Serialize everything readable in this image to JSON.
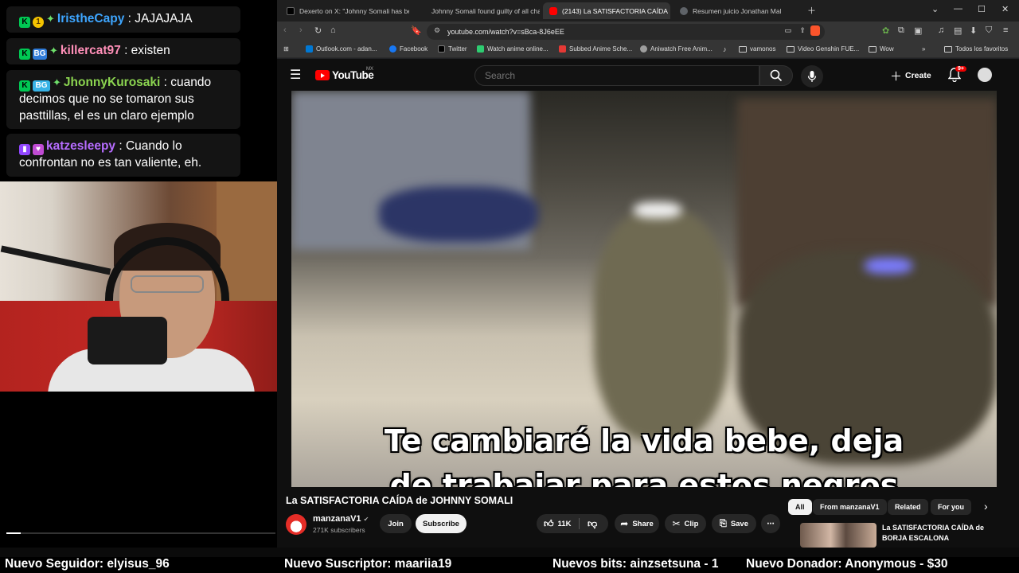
{
  "chat": {
    "messages": [
      {
        "user": "IristheCapy",
        "user_color": "#3ea6ff",
        "text": ": JAJAJAJA",
        "badges": [
          "prime-badge",
          "gold-badge"
        ]
      },
      {
        "user": "killercat97",
        "user_color": "#ff8fb8",
        "text": ": existen",
        "badges": [
          "prime-badge",
          "bits-badge"
        ]
      },
      {
        "user": "JhonnyKurosaki",
        "user_color": "#8bd450",
        "text": ": cuando decimos que no se tomaron sus pasttillas, el es un claro ejemplo",
        "badges": [
          "prime-badge",
          "sub-badge"
        ]
      },
      {
        "user": "katzesleepy",
        "user_color": "#b66cff",
        "text": ": Cuando lo confrontan no es tan valiente, eh.",
        "badges": [
          "twitch-badge",
          "heart-badge"
        ]
      }
    ]
  },
  "browser": {
    "tabs": [
      {
        "title": "Dexerto on X: \"Johnny Somali has be",
        "icon": "x-icon",
        "color": "#000000"
      },
      {
        "title": "Johnny Somali found guilty of all cha",
        "icon": "page-icon",
        "color": "#e02020"
      },
      {
        "title": "(2143) La SATISFACTORIA CAÍDA",
        "icon": "youtube-icon",
        "color": "#ff0000",
        "active": true
      },
      {
        "title": "Resumen juicio Jonathan Mal",
        "icon": "globe-icon",
        "color": "#5f6368"
      }
    ],
    "url": "youtube.com/watch?v=sBca-8J6eEE",
    "bookmarks": [
      {
        "label": "Outlook.com - adan...",
        "icon": "outlook-icon",
        "color": "#0078d4"
      },
      {
        "label": "Facebook",
        "icon": "facebook-icon",
        "color": "#1877f2"
      },
      {
        "label": "Twitter",
        "icon": "x-icon",
        "color": "#000000"
      },
      {
        "label": "Watch anime online...",
        "icon": "anime-icon",
        "color": "#2ecc71"
      },
      {
        "label": "Subbed Anime Sche...",
        "icon": "anime-icon",
        "color": "#e53935"
      },
      {
        "label": "Aniwatch Free Anim...",
        "icon": "aniwatch-icon",
        "color": "#9e9e9e"
      },
      {
        "label": "",
        "icon": "tiktok-icon",
        "color": "#ffffff"
      },
      {
        "label": "vamonos",
        "icon": "folder-icon"
      },
      {
        "label": "Video Genshin FUE...",
        "icon": "folder-icon"
      },
      {
        "label": "Wow",
        "icon": "folder-icon"
      },
      {
        "label": "Todos los favoritos",
        "icon": "folder-icon"
      }
    ]
  },
  "youtube": {
    "logo_text": "YouTube",
    "region": "MX",
    "search_placeholder": "Search",
    "create_label": "Create",
    "notif_count": "9+",
    "subtitle_line1": "Te cambiaré la vida bebe, deja",
    "subtitle_line2": "de trabajar para estos negros",
    "video_title": "La SATISFACTORIA CAÍDA de JOHNNY SOMALI",
    "channel_name": "manzanaV1",
    "subscribers": "271K subscribers",
    "join_label": "Join",
    "subscribe_label": "Subscribe",
    "likes": "11K",
    "share_label": "Share",
    "clip_label": "Clip",
    "save_label": "Save",
    "chips": [
      "All",
      "From manzanaV1",
      "Related",
      "For you"
    ],
    "rec_title": "La SATISFACTORIA CAÍDA de BORJA ESCALONA"
  },
  "ticker": {
    "follower": "Nuevo Seguidor: elyisus_96",
    "subscriber": "Nuevo Suscriptor: maariia19",
    "bits": "Nuevos bits: ainzsetsuna - 1",
    "donor": "Nuevo Donador: Anonymous - $30"
  }
}
